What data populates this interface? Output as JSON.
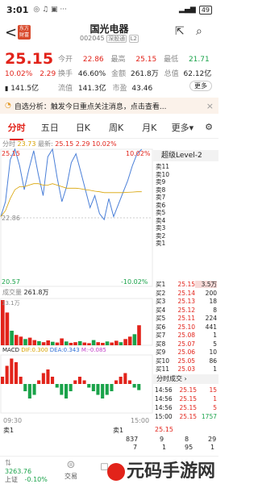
{
  "status_bar": {
    "time": "3:01",
    "icons": "◎ ♫ ▣ ···",
    "battery": "49"
  },
  "header": {
    "back": "<",
    "logo_text": "东方财富",
    "title": "国光电器",
    "code": "002045",
    "board_tag": "深股通",
    "level_tag": "L2"
  },
  "quote": {
    "price": "25.15",
    "change_pct": "10.02%",
    "change_amt": "2.29",
    "open_label": "今开",
    "open": "22.86",
    "high_label": "最高",
    "high": "25.15",
    "low_label": "最低",
    "low": "21.71",
    "turnover_label": "换手",
    "turnover": "46.60%",
    "amount_label": "金额",
    "amount": "261.8万",
    "total_mv_label": "总值",
    "total_mv": "62.12亿",
    "volume": "141.5亿",
    "float_label": "流值",
    "float_mv": "141.3亿",
    "pe_label": "市盈",
    "pe": "43.46",
    "more": "更多"
  },
  "notice": {
    "prefix": "自选分析：",
    "text": "触发今日重点关注消息，点击查看...",
    "close": "×"
  },
  "tabs": [
    "分时",
    "五日",
    "日K",
    "周K",
    "月K",
    "更多"
  ],
  "intraday": {
    "legend_prefix": "分时",
    "legend_avg": "23.73",
    "legend_price": "25.15",
    "legend_chg": "2.29",
    "legend_pct": "10.02%",
    "y_top": "25.15",
    "y_mid": "22.86",
    "y_bottom": "20.57",
    "pct_top": "10.02%",
    "pct_bottom": "-10.02%",
    "volume_label": "成交量",
    "volume_value": "261.8万",
    "volume_axis": "13.1万",
    "macd_label": "MACD",
    "macd_dif": "DIF:0.300",
    "macd_dea": "DEA:0.343",
    "macd_val": "M:-0.085",
    "time_start": "09:30",
    "time_end": "15:00"
  },
  "order_book": {
    "level_label": "超级Level-2",
    "asks": [
      {
        "label": "卖11",
        "price": "",
        "vol": ""
      },
      {
        "label": "卖10",
        "price": "",
        "vol": ""
      },
      {
        "label": "卖9",
        "price": "",
        "vol": ""
      },
      {
        "label": "卖8",
        "price": "",
        "vol": ""
      },
      {
        "label": "卖7",
        "price": "",
        "vol": ""
      },
      {
        "label": "卖6",
        "price": "",
        "vol": ""
      },
      {
        "label": "卖5",
        "price": "",
        "vol": ""
      },
      {
        "label": "卖4",
        "price": "",
        "vol": ""
      },
      {
        "label": "卖3",
        "price": "",
        "vol": ""
      },
      {
        "label": "卖2",
        "price": "",
        "vol": ""
      },
      {
        "label": "卖1",
        "price": "",
        "vol": ""
      }
    ],
    "bids": [
      {
        "label": "买1",
        "price": "25.15",
        "vol": "3.5万"
      },
      {
        "label": "买2",
        "price": "25.14",
        "vol": "200"
      },
      {
        "label": "买3",
        "price": "25.13",
        "vol": "18"
      },
      {
        "label": "买4",
        "price": "25.12",
        "vol": "8"
      },
      {
        "label": "买5",
        "price": "25.11",
        "vol": "224"
      },
      {
        "label": "买6",
        "price": "25.10",
        "vol": "441"
      },
      {
        "label": "买7",
        "price": "25.08",
        "vol": "1"
      },
      {
        "label": "买8",
        "price": "25.07",
        "vol": "5"
      },
      {
        "label": "买9",
        "price": "25.06",
        "vol": "10"
      },
      {
        "label": "买10",
        "price": "25.05",
        "vol": "86"
      },
      {
        "label": "买11",
        "price": "25.03",
        "vol": "1"
      }
    ],
    "trades_label": "分时成交",
    "trades": [
      {
        "time": "14:56",
        "price": "25.15",
        "vol": "15"
      },
      {
        "time": "14:56",
        "price": "25.15",
        "vol": "1"
      },
      {
        "time": "14:56",
        "price": "25.15",
        "vol": "5"
      },
      {
        "time": "15:00",
        "price": "25.15",
        "vol": "1757"
      }
    ]
  },
  "bottom": {
    "ask1_label": "卖1",
    "ask1_price": "25.15",
    "row2": [
      "837",
      "9",
      "8",
      "29"
    ],
    "row3": [
      "7",
      "1",
      "95",
      "1"
    ]
  },
  "nav": {
    "index_label": "上证",
    "index_value": "3263.76",
    "index_pct": "-0.10%",
    "trade_label": "交易",
    "watermark": "元码手游网"
  },
  "chart_data": [
    {
      "type": "line",
      "title": "",
      "xlabel": "",
      "ylabel": "",
      "x_range": [
        "09:30",
        "15:00"
      ],
      "ylim": [
        20.57,
        25.15
      ],
      "reference": 22.86,
      "series": [
        {
          "values": [
            22.9,
            23.4,
            24.8,
            25.15,
            24.6,
            23.8,
            24.5,
            25.1,
            24.3,
            23.6,
            24.9,
            25.15,
            24.2,
            23.4,
            23.9,
            24.7,
            25.0,
            24.4,
            23.8,
            23.2,
            23.6,
            23.0,
            22.8,
            23.5,
            22.9,
            23.3,
            23.7,
            24.1,
            24.6,
            25.0,
            25.15
          ]
        },
        {
          "values": [
            22.9,
            23.1,
            23.5,
            23.8,
            23.9,
            23.9,
            23.95,
            24.0,
            24.0,
            23.95,
            23.95,
            24.0,
            23.95,
            23.9,
            23.85,
            23.85,
            23.85,
            23.83,
            23.8,
            23.78,
            23.75,
            23.73,
            23.7,
            23.7,
            23.7,
            23.7,
            23.7,
            23.71,
            23.72,
            23.73,
            23.73
          ]
        }
      ]
    },
    {
      "type": "bar",
      "title": "",
      "ylim": [
        0,
        13.1
      ],
      "values": [
        13.1,
        9.5,
        4.2,
        3.0,
        2.5,
        1.8,
        2.2,
        1.5,
        1.2,
        0.9,
        1.4,
        1.0,
        0.8,
        2.0,
        1.1,
        0.7,
        0.9,
        1.2,
        0.8,
        0.6,
        1.5,
        0.9,
        0.7,
        1.1,
        0.8,
        1.3,
        0.9,
        1.8,
        2.5,
        3.2,
        5.8
      ]
    },
    {
      "type": "bar",
      "title": "",
      "values": [
        0.1,
        0.25,
        0.35,
        0.3,
        0.1,
        -0.1,
        -0.2,
        -0.15,
        0.05,
        0.15,
        0.2,
        0.1,
        -0.05,
        -0.15,
        -0.2,
        -0.1,
        0.05,
        0.1,
        0.05,
        -0.05,
        -0.1,
        -0.15,
        -0.2,
        -0.15,
        -0.1,
        0.05,
        0.1,
        0.15,
        0.05,
        -0.05,
        -0.085
      ]
    }
  ]
}
